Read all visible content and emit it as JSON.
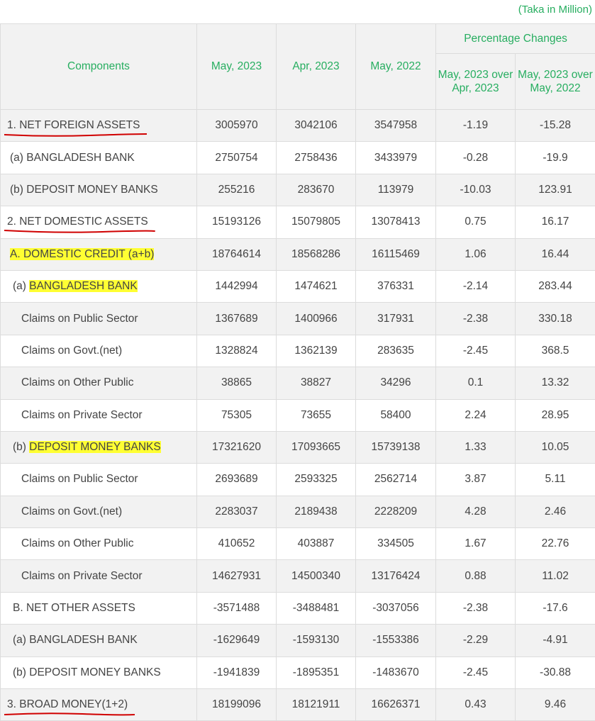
{
  "unit_note": "(Taka in Million)",
  "header": {
    "components": "Components",
    "col1": "May, 2023",
    "col2": "Apr, 2023",
    "col3": "May, 2022",
    "pct_group": "Percentage Changes",
    "pct1": "May, 2023 over Apr, 2023",
    "pct2": "May, 2023 over May, 2022"
  },
  "colors": {
    "accent": "#27ae60",
    "highlight": "#ffff33",
    "underline": "#d00000"
  },
  "rows": [
    {
      "label": "1. NET FOREIGN ASSETS",
      "c1": "3005970",
      "c2": "3042106",
      "c3": "3547958",
      "p1": "-1.19",
      "p2": "-15.28"
    },
    {
      "label": "(a) BANGLADESH BANK",
      "c1": "2750754",
      "c2": "2758436",
      "c3": "3433979",
      "p1": "-0.28",
      "p2": "-19.9"
    },
    {
      "label": "(b) DEPOSIT MONEY BANKS",
      "c1": "255216",
      "c2": "283670",
      "c3": "113979",
      "p1": "-10.03",
      "p2": "123.91"
    },
    {
      "label": "2. NET DOMESTIC ASSETS",
      "c1": "15193126",
      "c2": "15079805",
      "c3": "13078413",
      "p1": "0.75",
      "p2": "16.17"
    },
    {
      "label": "A. DOMESTIC CREDIT (a+b)",
      "c1": "18764614",
      "c2": "18568286",
      "c3": "16115469",
      "p1": "1.06",
      "p2": "16.44"
    },
    {
      "label_prefix": "(a) ",
      "label_hl": "BANGLADESH BANK",
      "c1": "1442994",
      "c2": "1474621",
      "c3": "376331",
      "p1": "-2.14",
      "p2": "283.44"
    },
    {
      "label": "Claims on Public Sector",
      "c1": "1367689",
      "c2": "1400966",
      "c3": "317931",
      "p1": "-2.38",
      "p2": "330.18"
    },
    {
      "label": "Claims on Govt.(net)",
      "c1": "1328824",
      "c2": "1362139",
      "c3": "283635",
      "p1": "-2.45",
      "p2": "368.5"
    },
    {
      "label": "Claims on Other Public",
      "c1": "38865",
      "c2": "38827",
      "c3": "34296",
      "p1": "0.1",
      "p2": "13.32"
    },
    {
      "label": "Claims on Private Sector",
      "c1": "75305",
      "c2": "73655",
      "c3": "58400",
      "p1": "2.24",
      "p2": "28.95"
    },
    {
      "label_prefix": "(b) ",
      "label_hl": "DEPOSIT MONEY BANKS",
      "c1": "17321620",
      "c2": "17093665",
      "c3": "15739138",
      "p1": "1.33",
      "p2": "10.05"
    },
    {
      "label": "Claims on Public Sector",
      "c1": "2693689",
      "c2": "2593325",
      "c3": "2562714",
      "p1": "3.87",
      "p2": "5.11"
    },
    {
      "label": "Claims on Govt.(net)",
      "c1": "2283037",
      "c2": "2189438",
      "c3": "2228209",
      "p1": "4.28",
      "p2": "2.46"
    },
    {
      "label": "Claims on Other Public",
      "c1": "410652",
      "c2": "403887",
      "c3": "334505",
      "p1": "1.67",
      "p2": "22.76"
    },
    {
      "label": "Claims on Private Sector",
      "c1": "14627931",
      "c2": "14500340",
      "c3": "13176424",
      "p1": "0.88",
      "p2": "11.02"
    },
    {
      "label": "B. NET OTHER ASSETS",
      "c1": "-3571488",
      "c2": "-3488481",
      "c3": "-3037056",
      "p1": "-2.38",
      "p2": "-17.6"
    },
    {
      "label": "(a) BANGLADESH BANK",
      "c1": "-1629649",
      "c2": "-1593130",
      "c3": "-1553386",
      "p1": "-2.29",
      "p2": "-4.91"
    },
    {
      "label": "(b) DEPOSIT MONEY BANKS",
      "c1": "-1941839",
      "c2": "-1895351",
      "c3": "-1483670",
      "p1": "-2.45",
      "p2": "-30.88"
    },
    {
      "label": "3. BROAD MONEY(1+2)",
      "c1": "18199096",
      "c2": "18121911",
      "c3": "16626371",
      "p1": "0.43",
      "p2": "9.46"
    }
  ]
}
